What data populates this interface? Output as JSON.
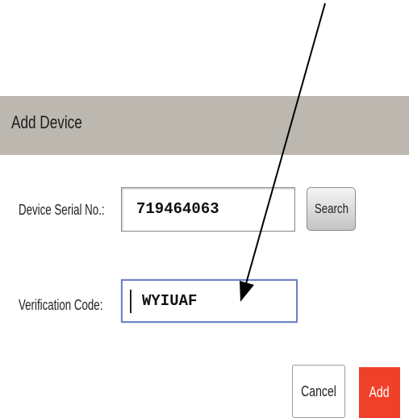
{
  "dialog": {
    "title": "Add Device",
    "header_color": "#bcb8b0"
  },
  "form": {
    "serial_label": "Device Serial No.:",
    "serial_value": "719464063",
    "code_label": "Verification Code:",
    "code_value": "WYIUAF"
  },
  "buttons": {
    "search_label": "Search",
    "cancel_label": "Cancel",
    "add_label": "Add",
    "add_color": "#f1402a"
  },
  "annotation": {
    "icon": "pointer-arrow-icon",
    "target": "verification-code-field"
  }
}
